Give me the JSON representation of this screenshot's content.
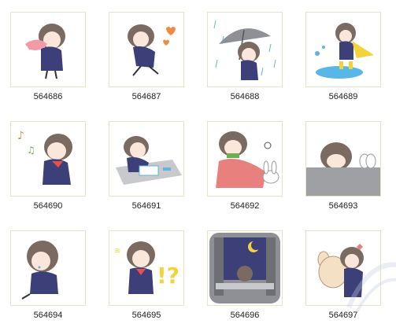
{
  "gallery": {
    "items": [
      {
        "id": "564686",
        "icon": "girl-with-pink-fish-sticker"
      },
      {
        "id": "564687",
        "icon": "girl-running-hearts-sticker"
      },
      {
        "id": "564688",
        "icon": "girl-umbrella-rain-sticker"
      },
      {
        "id": "564689",
        "icon": "girl-yellow-raincoat-puddle-sticker"
      },
      {
        "id": "564690",
        "icon": "girl-singing-music-notes-sticker"
      },
      {
        "id": "564691",
        "icon": "girl-drawing-at-desk-sticker"
      },
      {
        "id": "564692",
        "icon": "girl-with-blanket-and-bunny-sticker"
      },
      {
        "id": "564693",
        "icon": "girl-peeking-over-table-sticker"
      },
      {
        "id": "564694",
        "icon": "girl-sitting-crying-sticker"
      },
      {
        "id": "564695",
        "icon": "girl-surprised-exclamation-sticker"
      },
      {
        "id": "564696",
        "icon": "girl-at-night-window-sticker"
      },
      {
        "id": "564697",
        "icon": "girl-hugging-rabbit-sticker"
      }
    ]
  },
  "colors": {
    "hair": "#7a6a62",
    "uniform": "#3c3f78",
    "skin": "#fbe6dc",
    "pink": "#f29aa8",
    "yellow": "#f4d23a",
    "blue": "#58b7e6",
    "grey": "#9fa0a4",
    "tile_border": "#e6e3c8"
  }
}
